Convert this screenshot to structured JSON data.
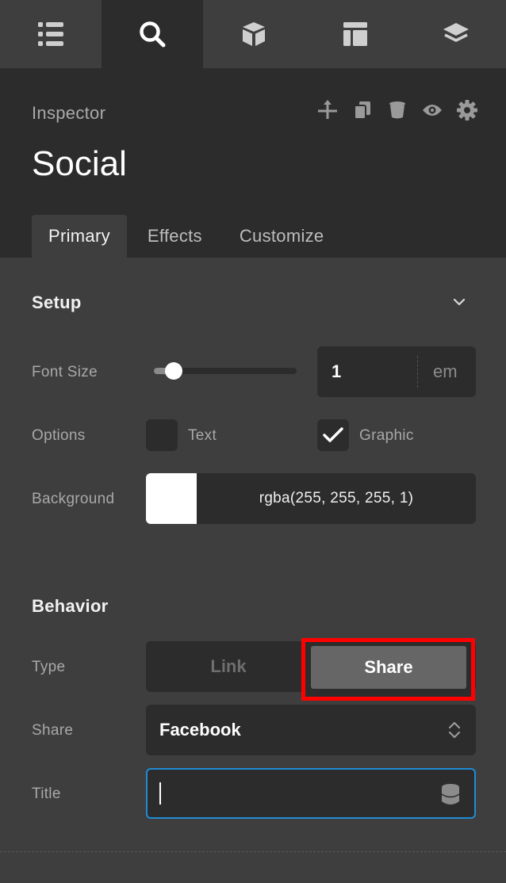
{
  "topnav": {
    "items": [
      {
        "icon": "list-icon",
        "active": false
      },
      {
        "icon": "search-icon",
        "active": true
      },
      {
        "icon": "cube-icon",
        "active": false
      },
      {
        "icon": "layout-icon",
        "active": false
      },
      {
        "icon": "layers-icon",
        "active": false
      }
    ]
  },
  "header": {
    "label": "Inspector",
    "title": "Social",
    "icons": [
      "move-up-icon",
      "duplicate-icon",
      "delete-icon",
      "visibility-icon",
      "settings-icon"
    ]
  },
  "tabs": [
    {
      "label": "Primary",
      "active": true
    },
    {
      "label": "Effects",
      "active": false
    },
    {
      "label": "Customize",
      "active": false
    }
  ],
  "setup": {
    "title": "Setup",
    "font_size": {
      "label": "Font Size",
      "value": "1",
      "unit": "em",
      "slider_fraction": 0.14
    },
    "options": {
      "label": "Options",
      "text_label": "Text",
      "text_checked": false,
      "graphic_label": "Graphic",
      "graphic_checked": true
    },
    "background": {
      "label": "Background",
      "value": "rgba(255, 255, 255, 1)",
      "swatch_color": "#ffffff"
    }
  },
  "behavior": {
    "title": "Behavior",
    "type": {
      "label": "Type",
      "options": [
        "Link",
        "Share"
      ],
      "selected": "Share"
    },
    "share": {
      "label": "Share",
      "value": "Facebook"
    },
    "title_field": {
      "label": "Title",
      "value": ""
    }
  },
  "colors": {
    "accent_focus": "#1f8bd6",
    "highlight_box": "#ff0000",
    "panel_bg": "#3e3e3e",
    "dark_bg": "#2c2c2c"
  }
}
